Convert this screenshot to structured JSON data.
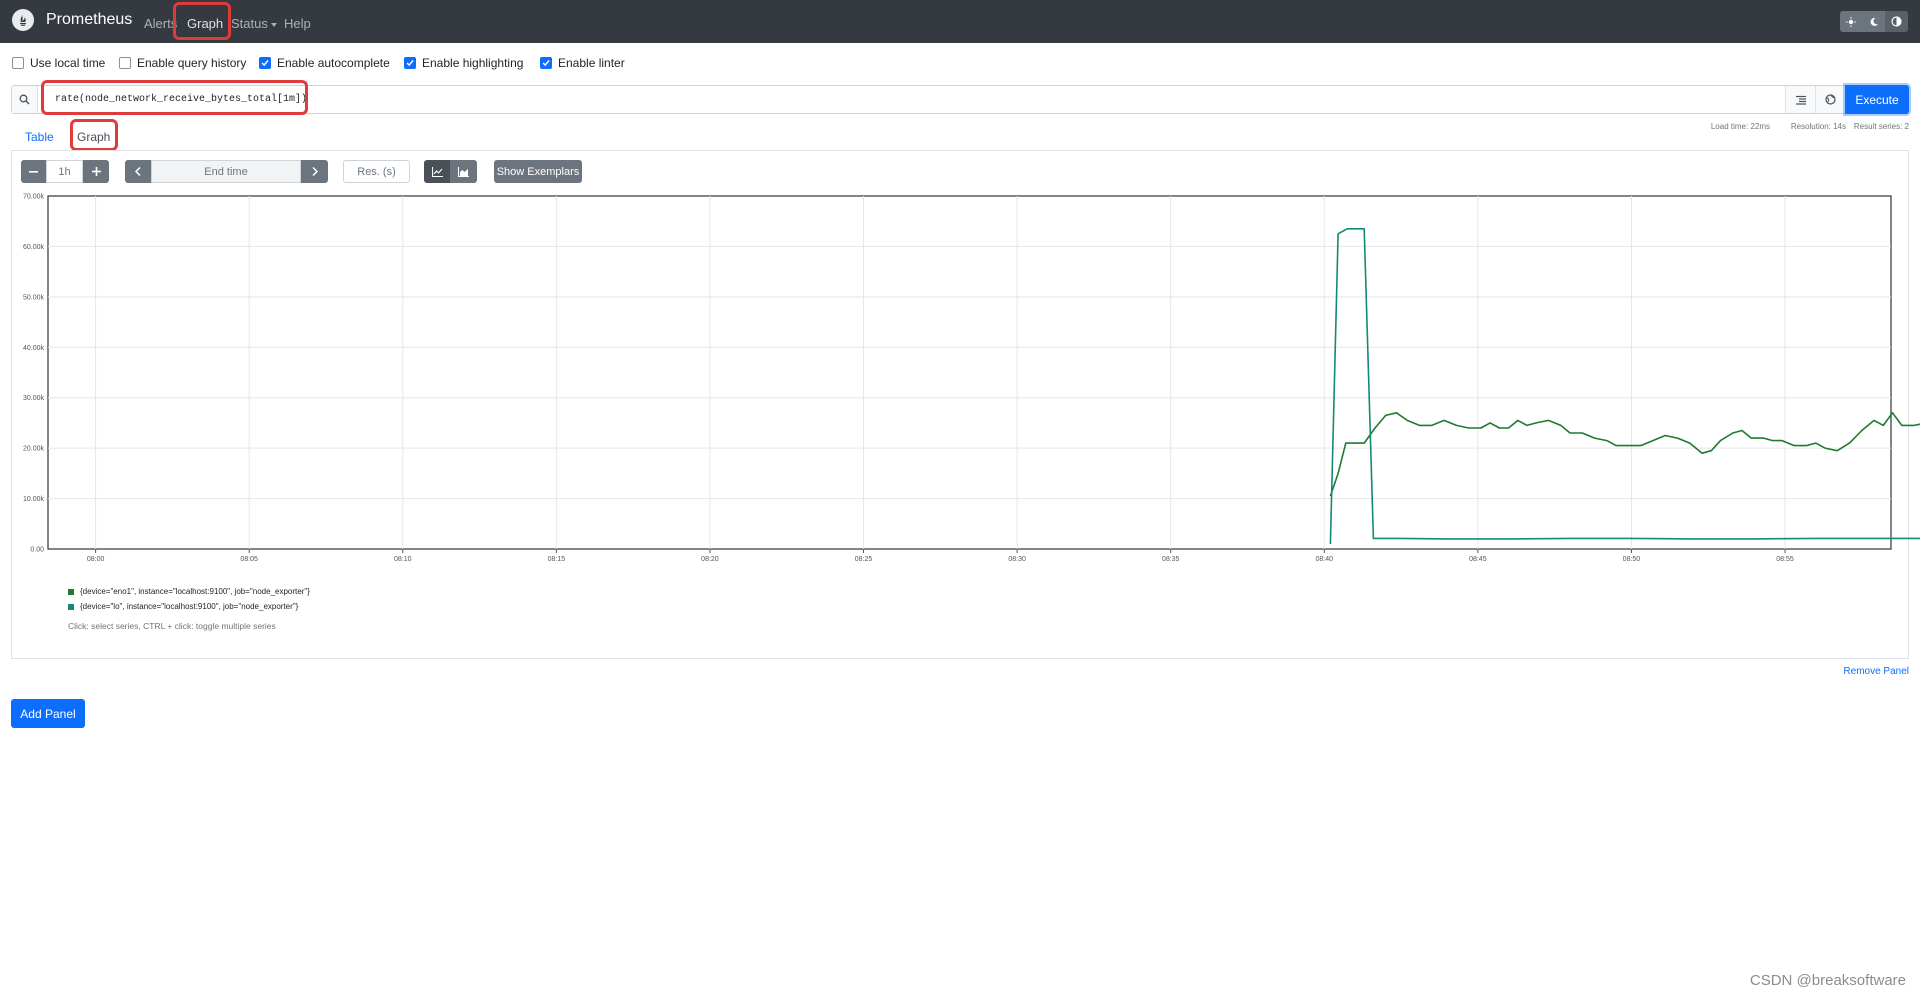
{
  "navbar": {
    "brand": "Prometheus",
    "links": [
      {
        "label": "Alerts"
      },
      {
        "label": "Graph"
      },
      {
        "label": "Status"
      },
      {
        "label": "Help"
      }
    ]
  },
  "options": {
    "use_local_time": {
      "label": "Use local time",
      "checked": false
    },
    "query_history": {
      "label": "Enable query history",
      "checked": false
    },
    "autocomplete": {
      "label": "Enable autocomplete",
      "checked": true
    },
    "highlighting": {
      "label": "Enable highlighting",
      "checked": true
    },
    "linter": {
      "label": "Enable linter",
      "checked": true
    }
  },
  "query": {
    "expression": "rate(node_network_receive_bytes_total[1m])",
    "execute_label": "Execute"
  },
  "stats": {
    "load_time": "Load time: 22ms",
    "resolution": "Resolution: 14s",
    "result_series": "Result series: 2"
  },
  "tabs": {
    "table": "Table",
    "graph": "Graph"
  },
  "controls": {
    "range": "1h",
    "end_time_placeholder": "End time",
    "res_placeholder": "Res. (s)",
    "exemplars_label": "Show Exemplars"
  },
  "legend": {
    "hint": "Click: select series, CTRL + click: toggle multiple series"
  },
  "panel": {
    "remove_label": "Remove Panel",
    "add_label": "Add Panel"
  },
  "watermark": "CSDN @breaksoftware",
  "colors": {
    "eno1": "#1e7b2e",
    "lo": "#128a76",
    "primary": "#0d6efd",
    "navbar": "#343a40"
  },
  "chart_data": {
    "type": "line",
    "yticks": [
      "0.00",
      "10.00k",
      "20.00k",
      "30.00k",
      "40.00k",
      "50.00k",
      "60.00k",
      "70.00k"
    ],
    "ylim": [
      0,
      70000
    ],
    "xticks": [
      "08:00",
      "08:05",
      "08:10",
      "08:15",
      "08:20",
      "08:25",
      "08:30",
      "08:35",
      "08:40",
      "08:45",
      "08:50",
      "08:55"
    ],
    "xlim_minutes": [
      58.45,
      118.45
    ],
    "grid": true,
    "legend_position": "bottom-left",
    "series": [
      {
        "name": "{device=\"eno1\", instance=\"localhost:9100\", job=\"node_exporter\"}",
        "color_key": "eno1",
        "points": [
          [
            100.2,
            10500
          ],
          [
            100.45,
            15000
          ],
          [
            100.7,
            21000
          ],
          [
            101.0,
            21000
          ],
          [
            101.3,
            21000
          ],
          [
            101.65,
            24000
          ],
          [
            102.0,
            26500
          ],
          [
            102.35,
            27000
          ],
          [
            102.7,
            25500
          ],
          [
            103.1,
            24500
          ],
          [
            103.5,
            24500
          ],
          [
            103.9,
            25500
          ],
          [
            104.3,
            24500
          ],
          [
            104.7,
            24000
          ],
          [
            105.1,
            24000
          ],
          [
            105.4,
            25000
          ],
          [
            105.7,
            24000
          ],
          [
            106.0,
            24000
          ],
          [
            106.3,
            25500
          ],
          [
            106.6,
            24500
          ],
          [
            106.9,
            25000
          ],
          [
            107.3,
            25500
          ],
          [
            107.7,
            24500
          ],
          [
            108.0,
            23000
          ],
          [
            108.4,
            23000
          ],
          [
            108.8,
            22000
          ],
          [
            109.2,
            21500
          ],
          [
            109.5,
            20500
          ],
          [
            109.9,
            20500
          ],
          [
            110.3,
            20500
          ],
          [
            110.7,
            21500
          ],
          [
            111.1,
            22500
          ],
          [
            111.5,
            22000
          ],
          [
            111.9,
            21000
          ],
          [
            112.3,
            19000
          ],
          [
            112.6,
            19500
          ],
          [
            112.9,
            21500
          ],
          [
            113.3,
            23000
          ],
          [
            113.6,
            23500
          ],
          [
            113.9,
            22000
          ],
          [
            114.3,
            22000
          ],
          [
            114.6,
            21500
          ],
          [
            114.9,
            21500
          ],
          [
            115.3,
            20500
          ],
          [
            115.7,
            20500
          ],
          [
            116.0,
            21000
          ],
          [
            116.3,
            20000
          ],
          [
            116.7,
            19500
          ],
          [
            117.1,
            21000
          ],
          [
            117.5,
            23500
          ],
          [
            117.9,
            25500
          ],
          [
            118.2,
            24500
          ],
          [
            118.5,
            27000
          ],
          [
            118.8,
            24500
          ],
          [
            119.2,
            24500
          ],
          [
            119.6,
            25000
          ],
          [
            119.9,
            21500
          ],
          [
            120.3,
            21500
          ],
          [
            120.6,
            22000
          ],
          [
            120.9,
            24500
          ]
        ]
      },
      {
        "name": "{device=\"lo\", instance=\"localhost:9100\", job=\"node_exporter\"}",
        "color_key": "lo",
        "points": [
          [
            100.2,
            1000
          ],
          [
            100.45,
            62500
          ],
          [
            100.75,
            63500
          ],
          [
            101.0,
            63500
          ],
          [
            101.3,
            63500
          ],
          [
            101.6,
            2100
          ],
          [
            102.5,
            2100
          ],
          [
            104.0,
            2000
          ],
          [
            106.0,
            2000
          ],
          [
            108.0,
            2100
          ],
          [
            110.0,
            2100
          ],
          [
            112.0,
            2000
          ],
          [
            114.0,
            2000
          ],
          [
            116.0,
            2100
          ],
          [
            118.0,
            2100
          ],
          [
            120.0,
            2100
          ],
          [
            120.9,
            2100
          ]
        ]
      }
    ]
  }
}
